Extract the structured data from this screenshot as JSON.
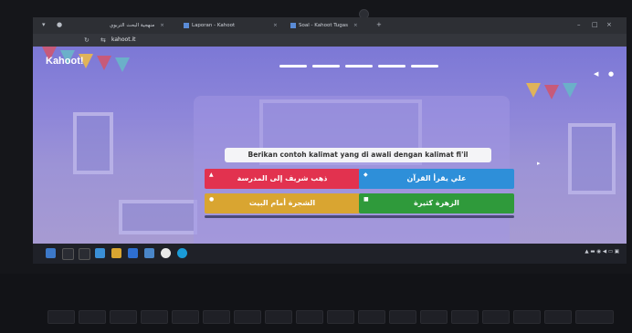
{
  "browser": {
    "tabs": [
      {
        "label": "منهجية البحث التربوي"
      },
      {
        "label": "Laporan - Kahoot"
      },
      {
        "label": "Soal - Kahoot Tugas"
      }
    ],
    "url": "kahoot.it"
  },
  "app": {
    "logo": "Kahoot!"
  },
  "question": {
    "text": "Berikan contoh kalimat yang di awali dengan kalimat fi'il"
  },
  "answers": [
    {
      "label": "ذهب شريف إلى المدرسة",
      "color": "#e2324f",
      "shape": "triangle-icon"
    },
    {
      "label": "علي يقرأ القرآن",
      "color": "#2e8fd9",
      "shape": "diamond-icon"
    },
    {
      "label": "الشجرة أمام البيت",
      "color": "#d9a531",
      "shape": "circle-icon"
    },
    {
      "label": "الزهرة كثيرة",
      "color": "#2f9a3b",
      "shape": "square-icon"
    }
  ]
}
